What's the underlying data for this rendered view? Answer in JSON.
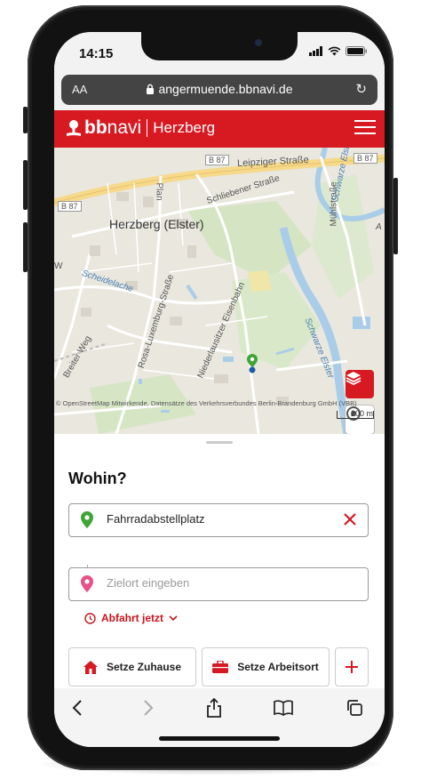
{
  "status_bar": {
    "time": "14:15"
  },
  "browser": {
    "text_size_label": "AA",
    "url": "angermuende.bbnavi.de"
  },
  "header": {
    "logo_bold": "bb",
    "logo_regular": "navi",
    "city": "Herzberg"
  },
  "map": {
    "city_label": "Herzberg (Elster)",
    "road_label_b87": "B 87",
    "street_labels": [
      "Leipziger Straße",
      "Schliebener Straße",
      "Mühlstraße",
      "Plan",
      "Scheidelache",
      "Rosa-Luxemburg-Straße",
      "Niederlausitzer Eisenbahn",
      "Breiter Weg",
      "Schwarze Elster"
    ],
    "edge_labels": [
      "A",
      "W"
    ],
    "attribution": "© OpenStreetMap Mitwirkende, Datensätze des Verkehrsverbundes Berlin-Brandenburg GmbH (VBB)",
    "scale": "200 m"
  },
  "sheet": {
    "title": "Wohin?",
    "origin_value": "Fahrradabstellplatz",
    "destination_placeholder": "Zielort eingeben",
    "depart_label": "Abfahrt jetzt",
    "home_label": "Setze Zuhause",
    "work_label": "Setze Arbeitsort"
  },
  "colors": {
    "brand_red": "#d71921",
    "origin_pin": "#3fa535",
    "destination_pin": "#e8508a"
  },
  "icons": {
    "url_lock": "lock-icon",
    "reload": "reload-icon",
    "menu": "hamburger-icon",
    "layers": "layers-icon",
    "locate": "locate-icon",
    "home": "home-icon",
    "work": "briefcase-icon",
    "add": "plus-icon"
  }
}
